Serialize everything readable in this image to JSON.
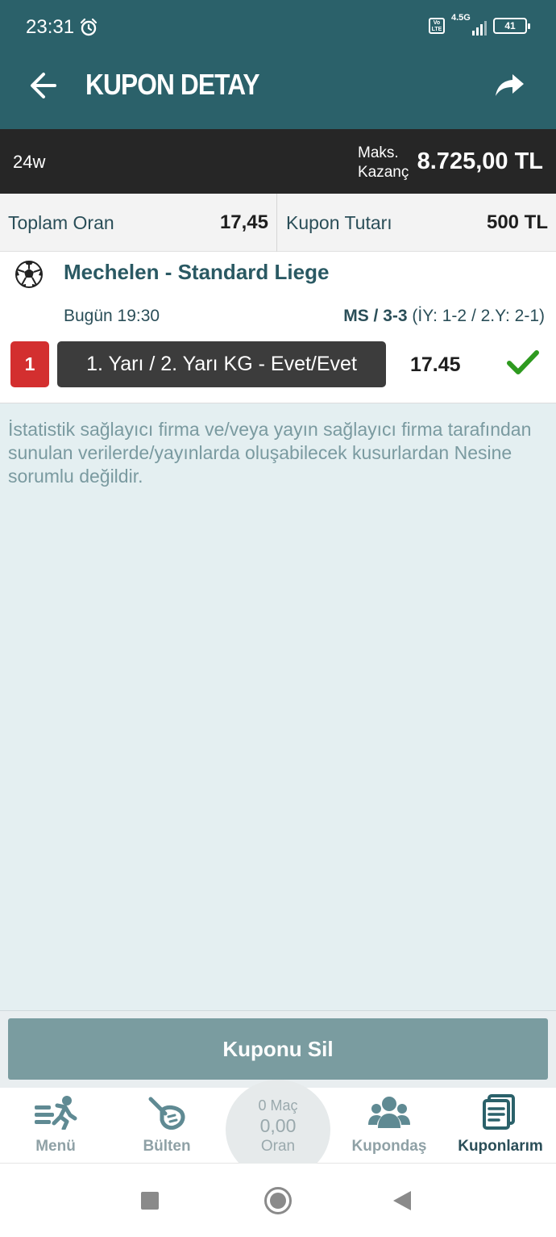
{
  "status_bar": {
    "time": "23:31",
    "network": "4.5G",
    "volte": "Vo LTE",
    "battery": "41"
  },
  "header": {
    "title": "KUPON DETAY"
  },
  "coupon": {
    "code": "24w",
    "max_win_label_line1": "Maks.",
    "max_win_label_line2": "Kazanç",
    "max_win_value": "8.725,00 TL",
    "total_odds_label": "Toplam Oran",
    "total_odds_value": "17,45",
    "amount_label": "Kupon Tutarı",
    "amount_value": "500 TL"
  },
  "match": {
    "title": "Mechelen - Standard Liege",
    "time": "Bugün 19:30",
    "score_main": "MS / 3-3",
    "score_detail": " (İY: 1-2 / 2.Y: 2-1)",
    "pick_number": "1",
    "bet": "1. Yarı / 2. Yarı KG - Evet/Evet",
    "odd": "17.45",
    "result": "won"
  },
  "disclaimer": "İstatistik sağlayıcı firma ve/veya yayın sağlayıcı firma tarafından sunulan verilerde/yayınlarda oluşabilecek kusurlardan Nesine sorumlu değildir.",
  "actions": {
    "delete_label": "Kuponu Sil"
  },
  "bottom_nav": {
    "items": [
      {
        "label": "Menü",
        "icon": "menu-runner-icon"
      },
      {
        "label": "Bülten",
        "icon": "bulletin-icon"
      },
      {
        "label": "Kupondaş",
        "icon": "people-icon"
      },
      {
        "label": "Kuponlarım",
        "icon": "coupons-icon"
      }
    ],
    "center": {
      "matches": "0 Maç",
      "odds": "0,00",
      "odds_label": "Oran"
    },
    "active": "Kuponlarım"
  },
  "colors": {
    "header": "#2b616a",
    "dark_strip": "#262626",
    "pick_number": "#d32f2f",
    "check": "#2e9a1f",
    "delete_button": "#7a9ca0"
  }
}
